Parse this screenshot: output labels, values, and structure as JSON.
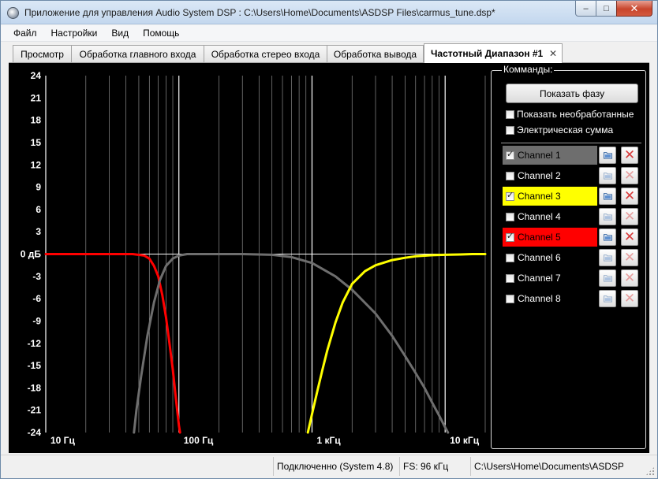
{
  "window": {
    "title": "Приложение для управления Audio System DSP : C:\\Users\\Home\\Documents\\ASDSP Files\\carmus_tune.dsp*",
    "minimize_label": "–",
    "maximize_label": "□",
    "close_label": "✕"
  },
  "menu": {
    "items": [
      "Файл",
      "Настройки",
      "Вид",
      "Помощь"
    ]
  },
  "tabs": [
    {
      "label": "Просмотр"
    },
    {
      "label": "Обработка главного входа"
    },
    {
      "label": "Обработка стерео входа"
    },
    {
      "label": "Обработка вывода"
    },
    {
      "label": "Частотный Диапазон #1",
      "active": true,
      "close_label": "✕"
    }
  ],
  "commands": {
    "legend": "Комманды:",
    "phase_button": "Показать фазу",
    "show_raw": {
      "label": "Показать необработанные",
      "checked": false
    },
    "electric_sum": {
      "label": "Электрическая сумма",
      "checked": false
    },
    "channels": [
      {
        "label": "Channel 1",
        "checked": true,
        "highlight": "#6e6e6e",
        "text_color": "#000000",
        "active": true
      },
      {
        "label": "Channel 2",
        "checked": false,
        "highlight": "",
        "text_color": "#ffffff",
        "active": false
      },
      {
        "label": "Channel 3",
        "checked": true,
        "highlight": "#ffff00",
        "text_color": "#000000",
        "active": true
      },
      {
        "label": "Channel 4",
        "checked": false,
        "highlight": "",
        "text_color": "#ffffff",
        "active": false
      },
      {
        "label": "Channel 5",
        "checked": true,
        "highlight": "#ff0000",
        "text_color": "#000000",
        "active": true
      },
      {
        "label": "Channel 6",
        "checked": false,
        "highlight": "",
        "text_color": "#ffffff",
        "active": false
      },
      {
        "label": "Channel 7",
        "checked": false,
        "highlight": "",
        "text_color": "#ffffff",
        "active": false
      },
      {
        "label": "Channel 8",
        "checked": false,
        "highlight": "",
        "text_color": "#ffffff",
        "active": false
      }
    ]
  },
  "status": {
    "connection": "Подключенно  (System 4.8)",
    "sample_rate": "FS: 96 кГц",
    "file_path": "C:\\Users\\Home\\Documents\\ASDSP Files\\carmus_tune.dsp"
  },
  "chart_data": {
    "type": "line",
    "x_scale": "log",
    "xlim": [
      10,
      20000
    ],
    "ylim": [
      -24,
      24
    ],
    "y_ticks": [
      24,
      21,
      18,
      15,
      12,
      9,
      6,
      3,
      0,
      -3,
      -6,
      -9,
      -12,
      -15,
      -18,
      -21,
      -24
    ],
    "y_tick_labels": [
      "24",
      "21",
      "18",
      "15",
      "12",
      "9",
      "6",
      "3",
      "0 дБ",
      "-3",
      "-6",
      "-9",
      "-12",
      "-15",
      "-18",
      "-21",
      "-24"
    ],
    "x_tick_labels": [
      {
        "value": 10,
        "label": "10 Гц"
      },
      {
        "value": 100,
        "label": "100 Гц"
      },
      {
        "value": 1000,
        "label": "1 кГц"
      },
      {
        "value": 10000,
        "label": "10 кГц"
      }
    ],
    "grid": true,
    "background": "#000000",
    "series": [
      {
        "name": "Channel 5",
        "color": "#ff0000",
        "x": [
          10,
          30,
          45,
          55,
          60,
          65,
          70,
          75,
          80,
          85,
          90,
          95,
          100,
          102
        ],
        "y": [
          0,
          0,
          0,
          -0.2,
          -0.6,
          -1.6,
          -3,
          -5.5,
          -8.5,
          -12,
          -15.5,
          -19.5,
          -23,
          -24
        ]
      },
      {
        "name": "Channel 1",
        "color": "#6e6e6e",
        "x": [
          46,
          48,
          52,
          58,
          65,
          72,
          80,
          90,
          100,
          115,
          130,
          150,
          200,
          300,
          500,
          700,
          1000,
          1500,
          2000,
          3000,
          4000,
          5000,
          6000,
          7000,
          8000,
          9000,
          10000,
          10500
        ],
        "y": [
          -24,
          -21,
          -16.5,
          -11,
          -6.5,
          -3.5,
          -1.6,
          -0.6,
          -0.2,
          0,
          0,
          0,
          0,
          0,
          -0.1,
          -0.4,
          -1.2,
          -3,
          -4.8,
          -8,
          -11,
          -13.7,
          -16,
          -18,
          -20,
          -21.7,
          -23.3,
          -24
        ]
      },
      {
        "name": "Channel 3",
        "color": "#ffff00",
        "x": [
          930,
          1000,
          1100,
          1200,
          1300,
          1500,
          1700,
          2000,
          2500,
          3000,
          4000,
          5000,
          6000,
          8000,
          10000,
          13000,
          16000,
          20000
        ],
        "y": [
          -24,
          -21.5,
          -18.3,
          -15.5,
          -13,
          -9.2,
          -6.5,
          -4,
          -2.3,
          -1.5,
          -0.8,
          -0.5,
          -0.3,
          -0.15,
          -0.1,
          -0.05,
          0,
          0
        ]
      }
    ]
  }
}
